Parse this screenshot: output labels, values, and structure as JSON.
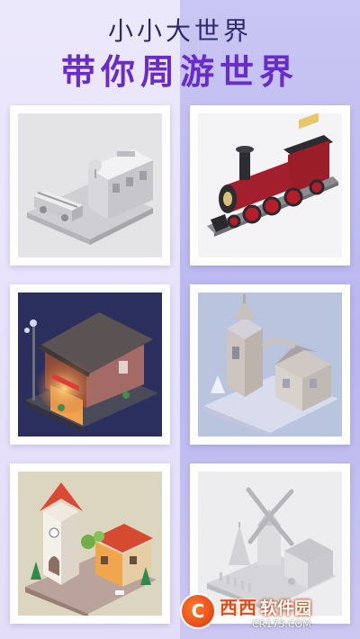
{
  "header": {
    "subtitle": "小小大世界",
    "title": "带你周游世界"
  },
  "gallery": {
    "cards": [
      {
        "icon": "fire-station-model-icon"
      },
      {
        "icon": "steam-locomotive-model-icon"
      },
      {
        "icon": "night-shop-model-icon"
      },
      {
        "icon": "clock-tower-model-icon"
      },
      {
        "icon": "colored-town-model-icon"
      },
      {
        "icon": "windmill-model-icon"
      }
    ]
  },
  "watermark": {
    "brand": "西西",
    "name": "软件园",
    "url": "CR173.COM"
  },
  "colors": {
    "title": "#6a2cc9",
    "subtitle": "#2e2a6c",
    "watermark": "#e8490f"
  }
}
